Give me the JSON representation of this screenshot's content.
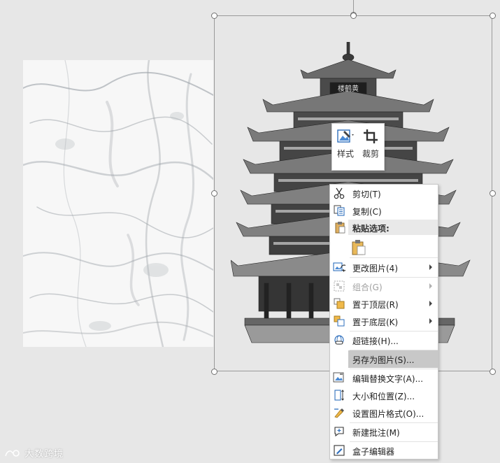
{
  "mini_toolbar": {
    "style_label": "样式",
    "crop_label": "裁剪"
  },
  "context_menu": {
    "cut": "剪切(T)",
    "copy": "复制(C)",
    "paste_options": "粘贴选项:",
    "change_picture": "更改图片(4)",
    "group": "组合(G)",
    "bring_to_front": "置于顶层(R)",
    "send_to_back": "置于底层(K)",
    "hyperlink": "超链接(H)...",
    "save_as_picture": "另存为图片(S)...",
    "edit_alt_text": "编辑替换文字(A)...",
    "size_position": "大小和位置(Z)...",
    "format_picture": "设置图片格式(O)...",
    "new_comment": "新建批注(M)",
    "box_editor": "盒子编辑器"
  },
  "tower_sign": "楼鹤黄",
  "watermark": "大数跨境"
}
